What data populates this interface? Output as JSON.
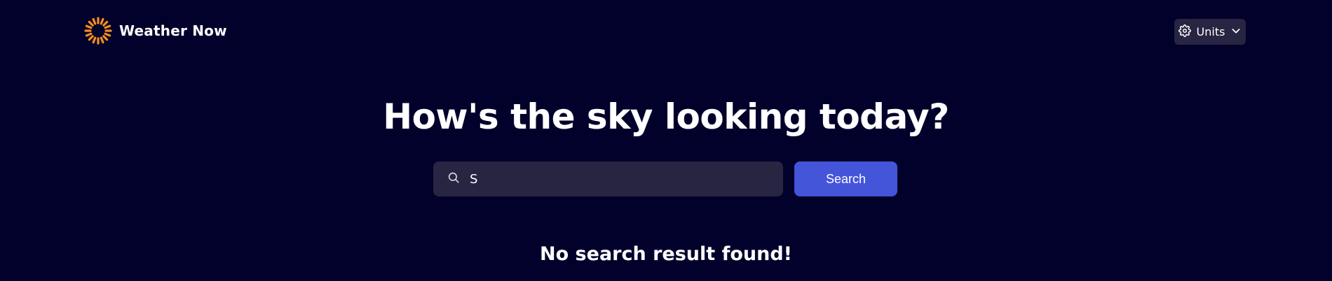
{
  "app": {
    "name": "Weather Now",
    "logo_icon": "sun-icon"
  },
  "header": {
    "units_label": "Units",
    "units_icon": "gear-icon",
    "units_caret_icon": "chevron-down-icon"
  },
  "hero": {
    "headline": "How's the sky looking today?"
  },
  "search": {
    "value": "S",
    "icon": "search-icon",
    "button_label": "Search"
  },
  "results": {
    "empty_message": "No search result found!"
  },
  "colors": {
    "background": "#02012B",
    "surface": "#272541",
    "accent": "#4455DA",
    "brand_orange": "#F88E1E"
  }
}
